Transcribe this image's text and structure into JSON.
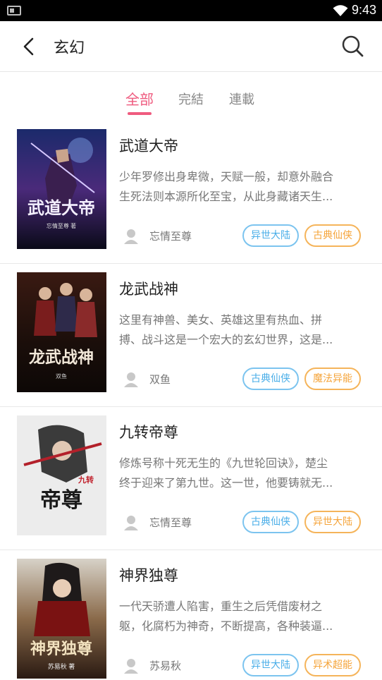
{
  "status_bar": {
    "time": "9:43"
  },
  "header": {
    "title": "玄幻",
    "back_icon": "chevron-left-icon",
    "search_icon": "search-icon"
  },
  "tabs": [
    {
      "label": "全部",
      "active": true
    },
    {
      "label": "完結",
      "active": false
    },
    {
      "label": "連載",
      "active": false
    }
  ],
  "accent_color": "#ef5b7f",
  "books": [
    {
      "title": "武道大帝",
      "desc_line1": "少年罗修出身卑微，天赋一般，却意外融合",
      "desc_line2": "生死法则本源所化至宝，从此身藏诸天生...",
      "author": "忘情至尊",
      "tags": [
        "异世大陆",
        "古典仙侠"
      ],
      "cover_title": "武道大帝",
      "cover_subtitle": "忘情至尊 著"
    },
    {
      "title": "龙武战神",
      "desc_line1": "这里有神兽、美女、英雄这里有热血、拼",
      "desc_line2": "搏、战斗这是一个宏大的玄幻世界，这是...",
      "author": "双鱼",
      "tags": [
        "古典仙侠",
        "魔法异能"
      ],
      "cover_title": "龙武战神",
      "cover_subtitle": "双鱼"
    },
    {
      "title": "九转帝尊",
      "desc_line1": "修炼号称十死无生的《九世轮回诀》，楚尘",
      "desc_line2": "终于迎来了第九世。这一世，他要铸就无...",
      "author": "忘情至尊",
      "tags": [
        "古典仙侠",
        "异世大陆"
      ],
      "cover_title": "帝尊",
      "cover_subtitle": "九转"
    },
    {
      "title": "神界独尊",
      "desc_line1": "一代天骄遭人陷害，重生之后凭借废材之",
      "desc_line2": "躯，化腐朽为神奇，不断提高，各种装逼...",
      "author": "苏易秋",
      "tags": [
        "异世大陆",
        "异术超能"
      ],
      "cover_title": "神界独尊",
      "cover_subtitle": "苏易秋 著"
    }
  ]
}
